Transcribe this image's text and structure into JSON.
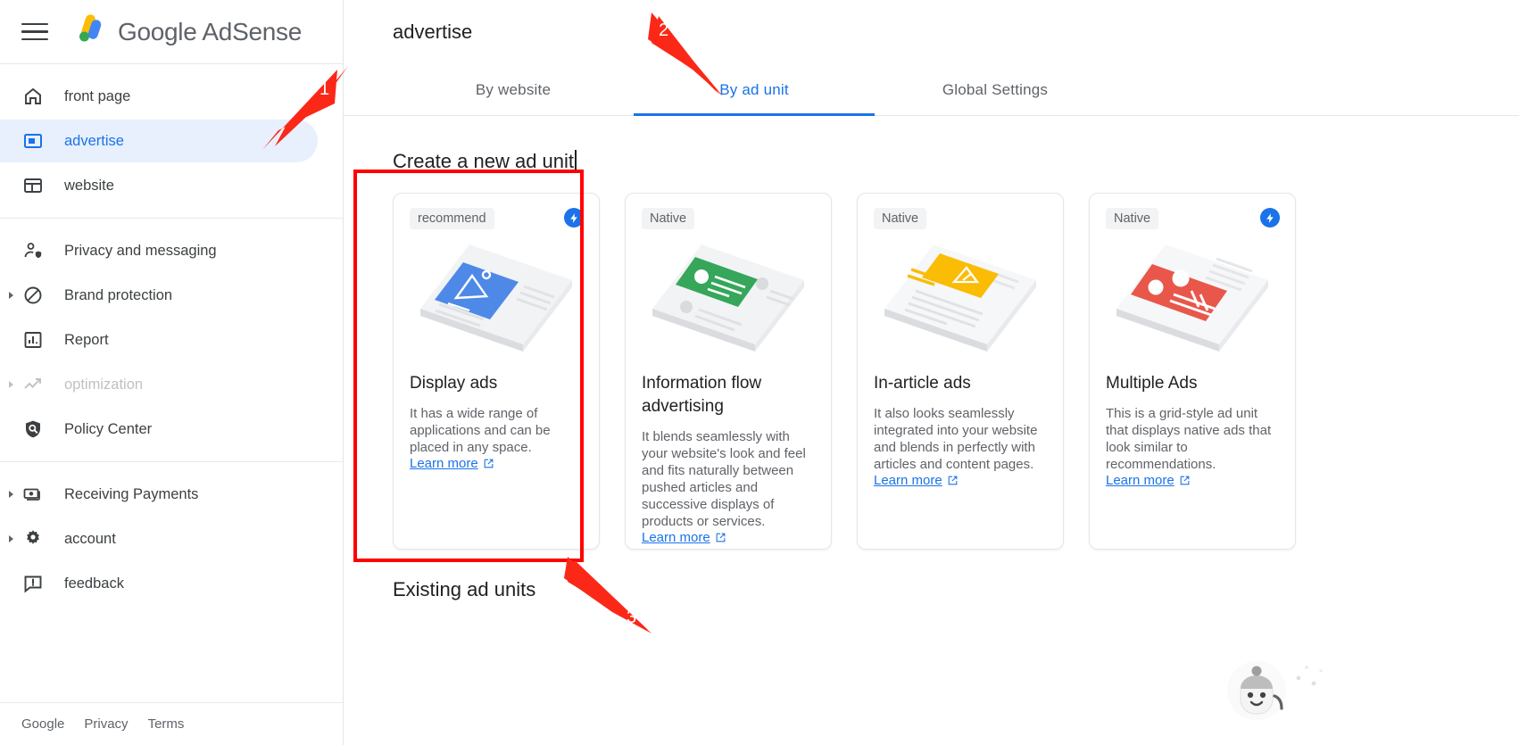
{
  "brand": {
    "name": "Google AdSense",
    "menu_icon": "hamburger-icon",
    "logo_icon": "adsense-logo-icon"
  },
  "sidebar": {
    "groups": [
      {
        "items": [
          {
            "label": "front page",
            "icon": "home-icon",
            "active": false,
            "expandable": false,
            "disabled": false
          },
          {
            "label": "advertise",
            "icon": "ad-unit-icon",
            "active": true,
            "expandable": false,
            "disabled": false
          },
          {
            "label": "website",
            "icon": "website-icon",
            "active": false,
            "expandable": false,
            "disabled": false
          }
        ]
      },
      {
        "items": [
          {
            "label": "Privacy and messaging",
            "icon": "person-shield-icon",
            "active": false,
            "expandable": false,
            "disabled": false
          },
          {
            "label": "Brand protection",
            "icon": "block-icon",
            "active": false,
            "expandable": true,
            "disabled": false
          },
          {
            "label": "Report",
            "icon": "bar-chart-icon",
            "active": false,
            "expandable": false,
            "disabled": false
          },
          {
            "label": "optimization",
            "icon": "trending-up-icon",
            "active": false,
            "expandable": true,
            "disabled": true
          },
          {
            "label": "Policy Center",
            "icon": "policy-shield-icon",
            "active": false,
            "expandable": false,
            "disabled": false
          }
        ]
      },
      {
        "items": [
          {
            "label": "Receiving Payments",
            "icon": "payments-icon",
            "active": false,
            "expandable": true,
            "disabled": false
          },
          {
            "label": "account",
            "icon": "gear-icon",
            "active": false,
            "expandable": true,
            "disabled": false
          },
          {
            "label": "feedback",
            "icon": "feedback-icon",
            "active": false,
            "expandable": false,
            "disabled": false
          }
        ]
      }
    ],
    "footer_links": [
      "Google",
      "Privacy",
      "Terms"
    ]
  },
  "header": {
    "title": "advertise"
  },
  "tabs": [
    {
      "label": "By website",
      "active": false
    },
    {
      "label": "By ad unit",
      "active": true
    },
    {
      "label": "Global Settings",
      "active": false
    }
  ],
  "main": {
    "create_section_title": "Create a new ad unit",
    "existing_section_title": "Existing ad units"
  },
  "cards": [
    {
      "badge": "recommend",
      "has_bolt": true,
      "title": "Display ads",
      "description": "It has a wide range of applications and can be placed in any space.",
      "link_label": "Learn more",
      "illustration": "display-ads-illustration",
      "accent": "#4285f4"
    },
    {
      "badge": "Native",
      "has_bolt": false,
      "title": "Information flow advertising",
      "description": "It blends seamlessly with your website's look and feel and fits naturally between pushed articles and successive displays of products or services.",
      "link_label": "Learn more",
      "illustration": "information-flow-illustration",
      "accent": "#34a853"
    },
    {
      "badge": "Native",
      "has_bolt": false,
      "title": "In-article ads",
      "description": "It also looks seamlessly integrated into your website and blends in perfectly with articles and content pages.",
      "link_label": "Learn more",
      "illustration": "in-article-illustration",
      "accent": "#fbbc04"
    },
    {
      "badge": "Native",
      "has_bolt": true,
      "title": "Multiple Ads",
      "description": "This is a grid-style ad unit that displays native ads that look similar to recommendations.",
      "link_label": "Learn more",
      "illustration": "multiple-ads-illustration",
      "accent": "#ea4335"
    }
  ],
  "annotations": {
    "color": "#ff0000",
    "markers": [
      {
        "number": "1",
        "target": "sidebar-item-advertise"
      },
      {
        "number": "2",
        "target": "tab-by-ad-unit"
      },
      {
        "number": "3",
        "target": "display-ads-card-highlight"
      }
    ]
  }
}
